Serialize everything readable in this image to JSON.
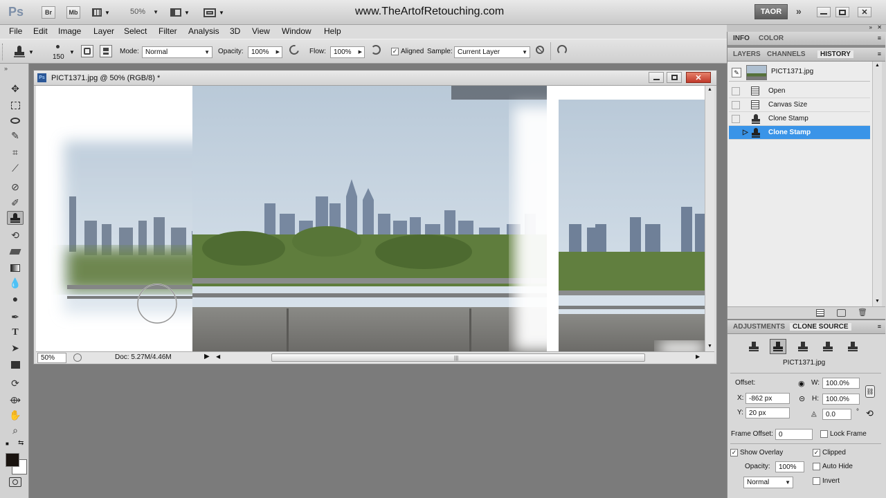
{
  "app": {
    "logo": "Ps",
    "bridge_label": "Br",
    "minibridge_label": "Mb",
    "zoom": "50%",
    "watermark": "www.TheArtofRetouching.com",
    "workspace": "TAOR"
  },
  "menu": [
    "File",
    "Edit",
    "Image",
    "Layer",
    "Select",
    "Filter",
    "Analysis",
    "3D",
    "View",
    "Window",
    "Help"
  ],
  "options": {
    "brush_size": "150",
    "mode_label": "Mode:",
    "mode_value": "Normal",
    "opacity_label": "Opacity:",
    "opacity_value": "100%",
    "flow_label": "Flow:",
    "flow_value": "100%",
    "aligned_label": "Aligned",
    "aligned_checked": true,
    "sample_label": "Sample:",
    "sample_value": "Current Layer"
  },
  "document": {
    "title": "PICT1371.jpg @ 50% (RGB/8) *",
    "zoom": "50%",
    "doc_info": "Doc: 5.27M/4.46M"
  },
  "panel_tabs_top": [
    "INFO",
    "COLOR"
  ],
  "panel_tabs_mid": [
    "LAYERS",
    "CHANNELS",
    "HISTORY"
  ],
  "history": {
    "snapshot": "PICT1371.jpg",
    "items": [
      {
        "label": "Open",
        "icon": "document-icon"
      },
      {
        "label": "Canvas Size",
        "icon": "document-icon"
      },
      {
        "label": "Clone Stamp",
        "icon": "stamp-icon"
      },
      {
        "label": "Clone Stamp",
        "icon": "stamp-icon",
        "selected": true
      }
    ]
  },
  "panel_tabs_bottom": [
    "ADJUSTMENTS",
    "CLONE SOURCE"
  ],
  "clone_source": {
    "source_name": "PICT1371.jpg",
    "offset_label": "Offset:",
    "x_label": "X:",
    "x_value": "-862 px",
    "y_label": "Y:",
    "y_value": "20 px",
    "w_label": "W:",
    "w_value": "100.0%",
    "h_label": "H:",
    "h_value": "100.0%",
    "angle_value": "0.0",
    "angle_unit": "°",
    "frame_offset_label": "Frame Offset:",
    "frame_offset_value": "0",
    "lock_frame_label": "Lock Frame",
    "lock_frame_checked": false,
    "show_overlay_label": "Show Overlay",
    "show_overlay_checked": true,
    "clipped_label": "Clipped",
    "clipped_checked": true,
    "overlay_opacity_label": "Opacity:",
    "overlay_opacity_value": "100%",
    "auto_hide_label": "Auto Hide",
    "auto_hide_checked": false,
    "blend_value": "Normal",
    "invert_label": "Invert",
    "invert_checked": false
  },
  "colors": {
    "selection": "#3a94e8",
    "foreground": "#1a1410",
    "background": "#ffffff"
  }
}
